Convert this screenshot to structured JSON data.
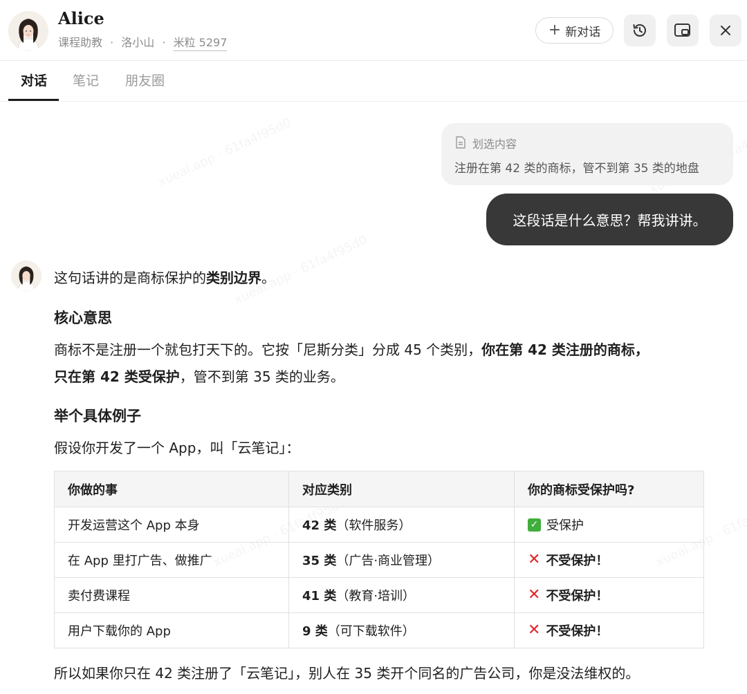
{
  "header": {
    "title": "Alice",
    "subtitle_role": "课程助教",
    "subtitle_sep": "·",
    "subtitle_place": "洛小山",
    "subtitle_points": "米粒 5297",
    "new_chat_label": "新对话"
  },
  "tabs": [
    {
      "label": "对话"
    },
    {
      "label": "笔记"
    },
    {
      "label": "朋友圈"
    }
  ],
  "selection": {
    "label": "划选内容",
    "text": "注册在第 42 类的商标，管不到第 35 类的地盘"
  },
  "user_message": "这段话是什么意思？帮我讲讲。",
  "answer": {
    "intro_pre": "这句话讲的是商标保护的",
    "intro_bold": "类别边界",
    "intro_post": "。",
    "h1": "核心意思",
    "p1_a": "商标不是注册一个就包打天下的。它按「尼斯分类」分成 45 个类别，",
    "p1_b": "你在第 42 类注册的商标，",
    "p1_c": "只在第 42 类受保护",
    "p1_d": "，管不到第 35 类的业务。",
    "h2": "举个具体例子",
    "p2": "假设你开发了一个 App，叫「云笔记」：",
    "table": {
      "headers": [
        "你做的事",
        "对应类别",
        "你的商标受保护吗?"
      ],
      "rows": [
        {
          "action": "开发运营这个 App 本身",
          "cat_num": "42 类",
          "cat_desc": "（软件服务）",
          "status": "受保护",
          "ok": true
        },
        {
          "action": "在 App 里打广告、做推广",
          "cat_num": "35 类",
          "cat_desc": "（广告·商业管理）",
          "status": "不受保护！",
          "ok": false
        },
        {
          "action": "卖付费课程",
          "cat_num": "41 类",
          "cat_desc": "（教育·培训）",
          "status": "不受保护！",
          "ok": false
        },
        {
          "action": "用户下载你的 App",
          "cat_num": "9 类",
          "cat_desc": "（可下载软件）",
          "status": "不受保护！",
          "ok": false
        }
      ]
    },
    "conclusion": "所以如果你只在 42 类注册了「云笔记」，别人在 35 类开个同名的广告公司，你是没法维权的。"
  },
  "watermark": "xueai.app · 61fa4f95d0",
  "colors": {
    "user_bubble": "#383838",
    "selection_bg": "#f2f2f2",
    "check_green": "#3fae3c",
    "cross_red": "#e0262b"
  },
  "icons": [
    "plus-icon",
    "history-icon",
    "window-icon",
    "close-icon",
    "document-icon",
    "check-icon",
    "cross-icon",
    "avatar-portrait"
  ]
}
